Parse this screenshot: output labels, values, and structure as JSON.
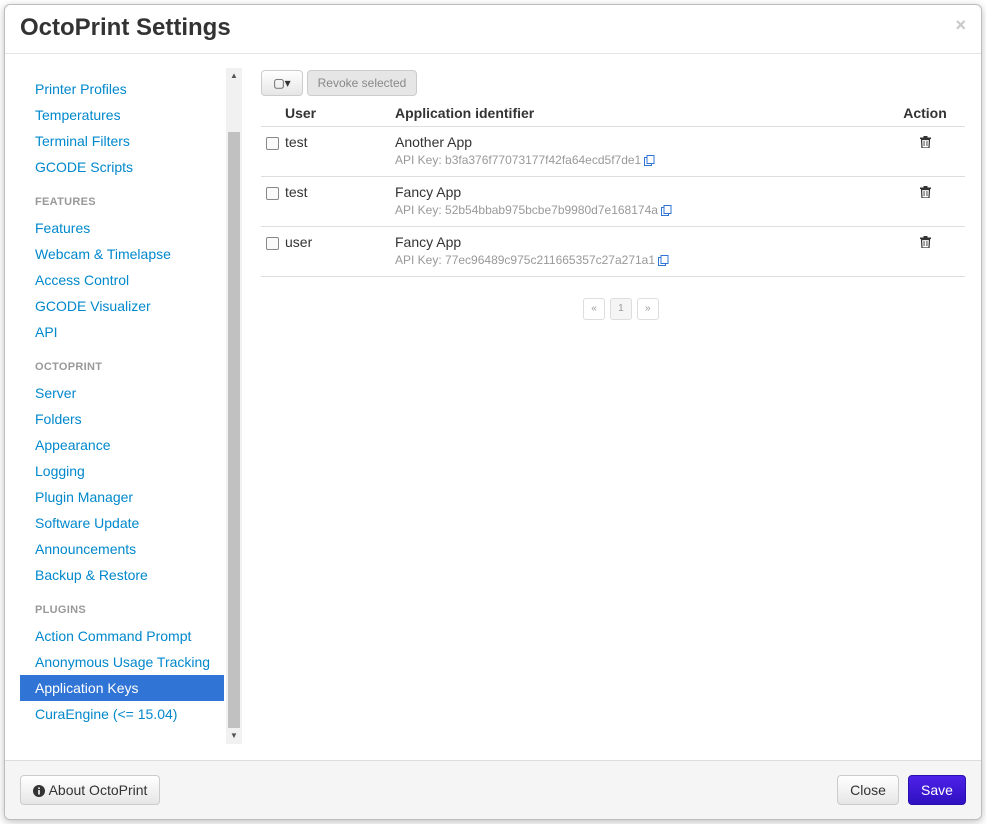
{
  "modal": {
    "title": "OctoPrint Settings",
    "close_glyph": "×"
  },
  "sidebar": {
    "groups": [
      {
        "header": "",
        "items": [
          "Printer Profiles",
          "Temperatures",
          "Terminal Filters",
          "GCODE Scripts"
        ]
      },
      {
        "header": "FEATURES",
        "items": [
          "Features",
          "Webcam & Timelapse",
          "Access Control",
          "GCODE Visualizer",
          "API"
        ]
      },
      {
        "header": "OCTOPRINT",
        "items": [
          "Server",
          "Folders",
          "Appearance",
          "Logging",
          "Plugin Manager",
          "Software Update",
          "Announcements",
          "Backup & Restore"
        ]
      },
      {
        "header": "PLUGINS",
        "items": [
          "Action Command Prompt",
          "Anonymous Usage Tracking",
          "Application Keys",
          "CuraEngine (<= 15.04)"
        ]
      }
    ],
    "active_item": "Application Keys"
  },
  "toolbar": {
    "select_label": "▢▾",
    "revoke_label": "Revoke selected"
  },
  "table": {
    "headers": {
      "user": "User",
      "app": "Application identifier",
      "action": "Action"
    },
    "api_prefix": "API Key: ",
    "rows": [
      {
        "user": "test",
        "app": "Another App",
        "key": "b3fa376f77073177f42fa64ecd5f7de1"
      },
      {
        "user": "test",
        "app": "Fancy App",
        "key": "52b54bbab975bcbe7b9980d7e168174a"
      },
      {
        "user": "user",
        "app": "Fancy App",
        "key": "77ec96489c975c211665357c27a271a1"
      }
    ]
  },
  "pagination": {
    "prev": "«",
    "current": "1",
    "next": "»"
  },
  "footer": {
    "about_label": "About OctoPrint",
    "close_label": "Close",
    "save_label": "Save"
  },
  "colors": {
    "accent": "#3074d6",
    "link": "#0088cc",
    "save": "#3a18d4"
  }
}
